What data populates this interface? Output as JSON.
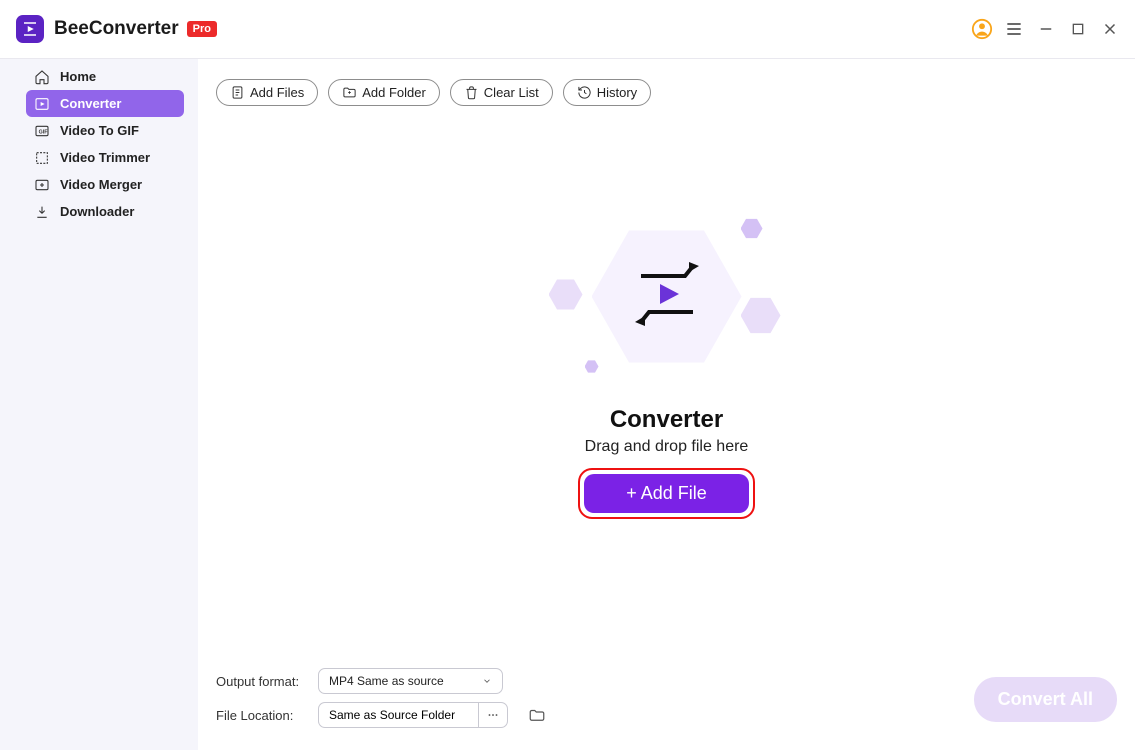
{
  "app": {
    "title": "BeeConverter",
    "badge": "Pro"
  },
  "sidebar": {
    "items": [
      {
        "label": "Home"
      },
      {
        "label": "Converter"
      },
      {
        "label": "Video To GIF"
      },
      {
        "label": "Video Trimmer"
      },
      {
        "label": "Video Merger"
      },
      {
        "label": "Downloader"
      }
    ],
    "active_index": 1
  },
  "toolbar": {
    "add_files": "Add Files",
    "add_folder": "Add Folder",
    "clear_list": "Clear List",
    "history": "History"
  },
  "dropzone": {
    "title": "Converter",
    "subtitle": "Drag and drop file here",
    "add_button": "+ Add File"
  },
  "footer": {
    "output_format_label": "Output format:",
    "output_format_value": "MP4 Same as source",
    "location_label": "File Location:",
    "location_value": "Same as Source Folder"
  },
  "convert_all_label": "Convert All"
}
